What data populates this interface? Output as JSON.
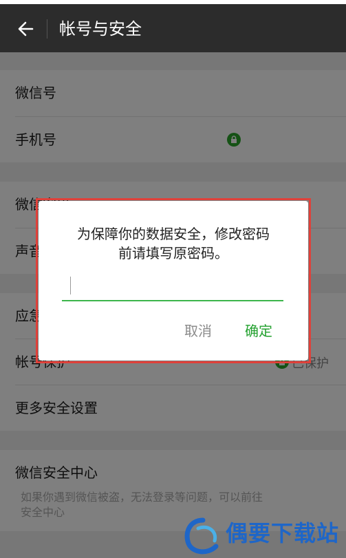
{
  "header": {
    "title": "帐号与安全",
    "back_icon": "arrow-left-icon"
  },
  "account_group": [
    {
      "label": "微信号"
    },
    {
      "label": "手机号"
    }
  ],
  "mid_group": [
    {
      "label": "微信密码"
    },
    {
      "label": "声音锁"
    }
  ],
  "security_group": [
    {
      "label": "应急联系人"
    },
    {
      "label": "帐号保护",
      "status": "已保护"
    },
    {
      "label": "更多安全设置"
    }
  ],
  "security_center": {
    "label": "微信安全中心",
    "desc_line1": "如果你遇到微信被盗，无法登录等问题，可以前往",
    "desc_line2": "安全中心"
  },
  "dialog": {
    "message_line1": "为保障你的数据安全，修改密码",
    "message_line2": "前请填写原密码。",
    "cancel": "取消",
    "confirm": "确定",
    "input_value": ""
  },
  "watermark": {
    "text": "偶要下载站"
  },
  "colors": {
    "header_bg": "#2c2c2c",
    "accent_green": "#23a12f",
    "highlight_red": "#e0413a",
    "watermark_blue": "#1e66c8"
  }
}
